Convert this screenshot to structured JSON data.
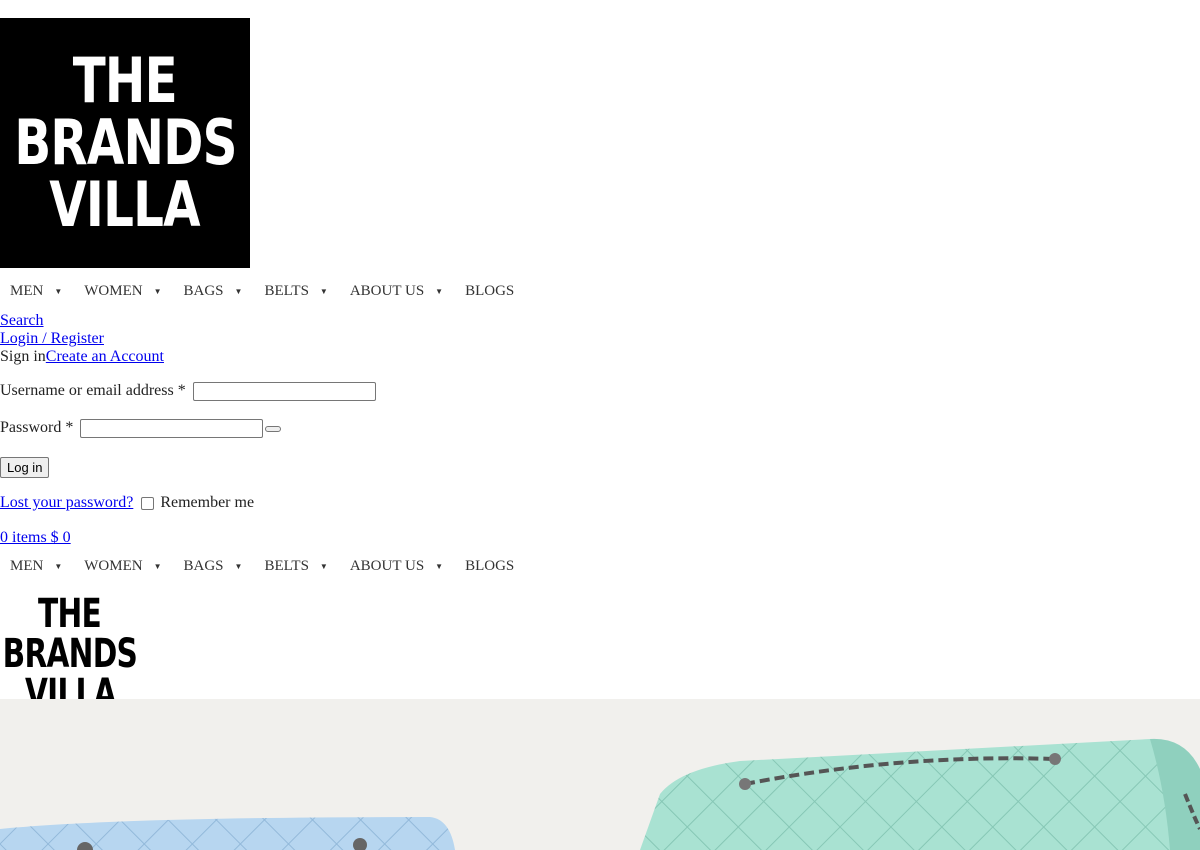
{
  "logo": {
    "lines": [
      "THE",
      "BRANDS",
      "VILLA"
    ]
  },
  "nav": [
    {
      "label": "MEN",
      "has_dropdown": true
    },
    {
      "label": "WOMEN",
      "has_dropdown": true
    },
    {
      "label": "BAGS",
      "has_dropdown": true
    },
    {
      "label": "BELTS",
      "has_dropdown": true
    },
    {
      "label": "ABOUT US",
      "has_dropdown": true
    },
    {
      "label": "BLOGS",
      "has_dropdown": false
    }
  ],
  "header": {
    "search_link": "Search",
    "login_register_link": "Login / Register"
  },
  "login_form": {
    "sign_in_label": "Sign in",
    "create_account_link": "Create an Account",
    "username_label": "Username or email address *",
    "username_value": "",
    "password_label": "Password *",
    "password_value": "",
    "login_button": "Log in",
    "lost_password_link": "Lost your password?",
    "remember_label": "Remember me"
  },
  "cart": {
    "link_text": "0 items $ 0"
  },
  "colors": {
    "logo_bg": "#000000",
    "link": "#0000ee",
    "hero_bg": "#f1f0ed",
    "bag_mint": "#a9e2d2",
    "bag_blue": "#b7d6f0"
  }
}
